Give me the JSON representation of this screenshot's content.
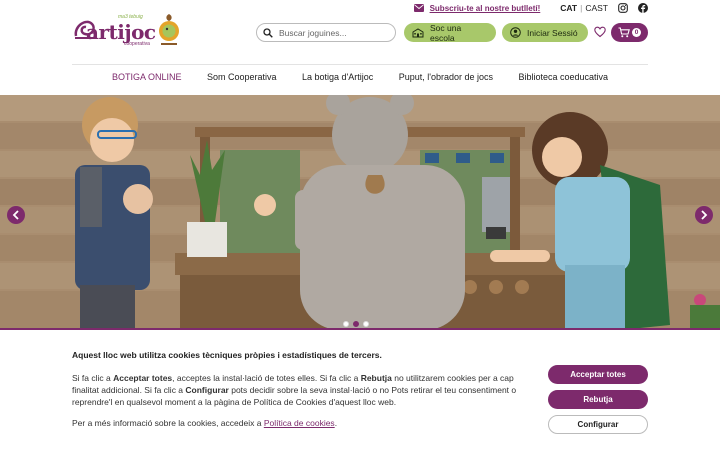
{
  "header": {
    "logo_text": "artijoc",
    "logo_sub": "cooperativa",
    "logo_tag": "ma3 tebuig",
    "newsletter_label": "Subscriu-te al nostre butlletí!",
    "lang_active": "CAT",
    "lang_other": "CAST",
    "search_placeholder": "Buscar joguines...",
    "school_label": "Soc una escola",
    "login_label": "Iniciar Sessió",
    "cart_count": "0"
  },
  "nav": {
    "items": [
      {
        "label": "BOTIGA ONLINE"
      },
      {
        "label": "Som Cooperativa"
      },
      {
        "label": "La botiga d'Artijoc"
      },
      {
        "label": "Puput, l'obrador de jocs"
      },
      {
        "label": "Biblioteca coeducativa"
      }
    ]
  },
  "carousel": {
    "slide_count": 3,
    "active_index": 1
  },
  "cookie": {
    "title": "Aquest lloc web utilitza cookies tècniques pròpies i estadístiques de tercers.",
    "p1_a": "Si fa clic a ",
    "p1_accept": "Acceptar totes",
    "p1_b": ", acceptes la instal·lació de totes elles. Si fa clic a ",
    "p1_reject": "Rebutja",
    "p1_c": " no utilitzarem cookies per a cap finalitat addicional. Si fa clic a ",
    "p1_config": "Configurar",
    "p1_d": " pots decidir sobre la seva instal·lació o no Pots retirar el teu consentiment o reprendre'l en qualsevol moment a la pàgina de Política de Cookies d'aquest lloc web.",
    "more_a": "Per a més informació sobre la cookies, accedeix a ",
    "more_link": "Política de cookies",
    "more_b": ".",
    "accept_label": "Acceptar totes",
    "reject_label": "Rebutja",
    "config_label": "Configurar"
  },
  "colors": {
    "brand": "#7d2a6c",
    "accent_green": "#a8c86a"
  }
}
